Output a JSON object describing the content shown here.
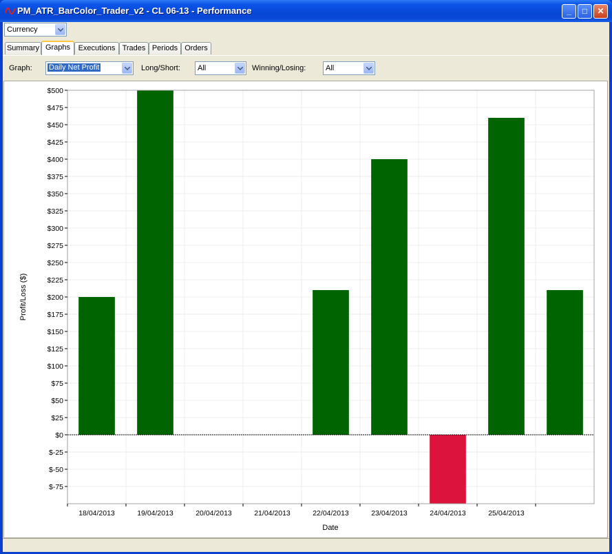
{
  "window": {
    "title": "PM_ATR_BarColor_Trader_v2 - CL 06-13 - Performance",
    "controls": {
      "minimize": "_",
      "maximize": "□",
      "close": "✕"
    },
    "icon": "strategy-wave-icon"
  },
  "display_unit": {
    "selected": "Currency"
  },
  "tabs": [
    {
      "label": "Summary"
    },
    {
      "label": "Graphs"
    },
    {
      "label": "Executions"
    },
    {
      "label": "Trades"
    },
    {
      "label": "Periods"
    },
    {
      "label": "Orders"
    }
  ],
  "toolbar": {
    "graph_label": "Graph:",
    "graph_value": "Daily Net Profit",
    "longshort_label": "Long/Short:",
    "longshort_value": "All",
    "winlose_label": "Winning/Losing:",
    "winlose_value": "All"
  },
  "colors": {
    "positive": "#006400",
    "negative": "#dc143c",
    "accent": "#316ac5"
  },
  "chart_data": {
    "type": "bar",
    "xlabel": "Date",
    "ylabel": "Profit/Loss ($)",
    "ylim": [
      -100,
      500
    ],
    "yticks": [
      500,
      475,
      450,
      425,
      400,
      375,
      350,
      325,
      300,
      275,
      250,
      225,
      200,
      175,
      150,
      125,
      100,
      75,
      50,
      25,
      0,
      -25,
      -50,
      -75
    ],
    "ytick_labels": [
      "$500",
      "$475",
      "$450",
      "$425",
      "$400",
      "$375",
      "$350",
      "$325",
      "$300",
      "$275",
      "$250",
      "$225",
      "$200",
      "$175",
      "$150",
      "$125",
      "$100",
      "$75",
      "$50",
      "$25",
      "$0",
      "$-25",
      "$-50",
      "$-75"
    ],
    "categories": [
      "18/04/2013",
      "19/04/2013",
      "20/04/2013",
      "21/04/2013",
      "22/04/2013",
      "23/04/2013",
      "24/04/2013",
      "25/04/2013",
      ""
    ],
    "values": [
      200,
      500,
      0,
      0,
      210,
      400,
      -100,
      460,
      210
    ],
    "grid": true,
    "zero_line": "dashed"
  }
}
